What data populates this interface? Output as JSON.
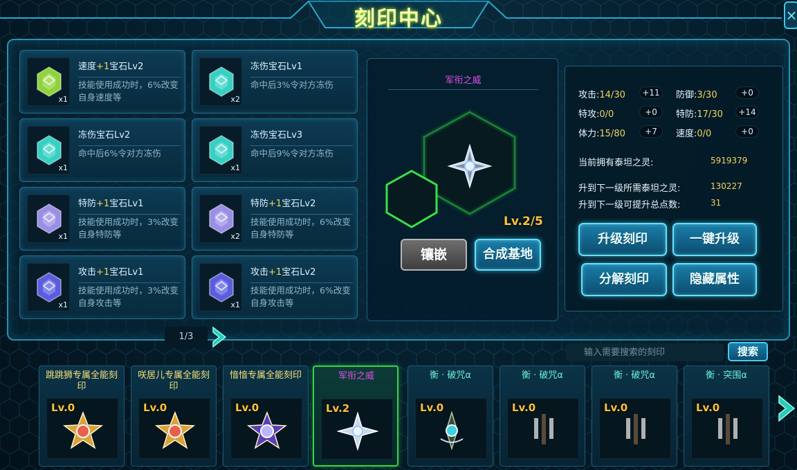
{
  "title": "刻印中心",
  "close_icon": "×",
  "inventory": {
    "items": [
      {
        "name": "速度",
        "plus": "+1",
        "rest": "宝石Lv2",
        "desc": "技能使用成功时，6%改变自身速度等",
        "count": "x1",
        "icon": "green-gem-icon",
        "color": "#8fd33a"
      },
      {
        "name": "冻伤宝石Lv1",
        "plus": "",
        "rest": "",
        "desc": "命中后3%令对方冻伤",
        "count": "x2",
        "icon": "teal-gem-icon",
        "color": "#35d1c3"
      },
      {
        "name": "冻伤宝石Lv2",
        "plus": "",
        "rest": "",
        "desc": "命中后6%令对方冻伤",
        "count": "x1",
        "icon": "teal-gem-icon",
        "color": "#35d1c3"
      },
      {
        "name": "冻伤宝石Lv3",
        "plus": "",
        "rest": "",
        "desc": "命中后9%令对方冻伤",
        "count": "x1",
        "icon": "teal-gem-icon",
        "color": "#35d1c3"
      },
      {
        "name": "特防",
        "plus": "+1",
        "rest": "宝石Lv1",
        "desc": "技能使用成功时，3%改变自身特防等",
        "count": "x1",
        "icon": "lilac-gem-icon",
        "color": "#9a8ee6"
      },
      {
        "name": "特防",
        "plus": "+1",
        "rest": "宝石Lv2",
        "desc": "技能使用成功时，6%改变自身特防等",
        "count": "x2",
        "icon": "lilac-gem-icon",
        "color": "#9a8ee6"
      },
      {
        "name": "攻击",
        "plus": "+1",
        "rest": "宝石Lv1",
        "desc": "技能使用成功时，3%改变自身攻击等",
        "count": "x1",
        "icon": "blue-gem-icon",
        "color": "#5a5de0"
      },
      {
        "name": "攻击",
        "plus": "+1",
        "rest": "宝石Lv2",
        "desc": "技能使用成功时，6%改变自身攻击等",
        "count": "x1",
        "icon": "blue-gem-icon",
        "color": "#5a5de0"
      }
    ],
    "page": "1/3"
  },
  "center": {
    "name": "军衔之威",
    "level": "Lv.2/5",
    "inlay_label": "镶嵌",
    "synth_label": "合成基地"
  },
  "stats": {
    "attack": {
      "label": "攻击:",
      "value": "14/30",
      "bonus": "+11"
    },
    "defense": {
      "label": "防御:",
      "value": "3/30",
      "bonus": "+0"
    },
    "sp_attack": {
      "label": "特攻:",
      "value": "0/0",
      "bonus": "+0"
    },
    "sp_defense": {
      "label": "特防:",
      "value": "17/30",
      "bonus": "+14"
    },
    "stamina": {
      "label": "体力:",
      "value": "15/80",
      "bonus": "+7"
    },
    "speed": {
      "label": "速度:",
      "value": "0/0",
      "bonus": "+0"
    }
  },
  "info": {
    "own_label": "当前拥有泰坦之灵:",
    "own_value": "5919379",
    "need_label": "升到下一级所需泰坦之灵:",
    "need_value": "130227",
    "points_label": "升到下一级可提升总点数:",
    "points_value": "31"
  },
  "actions": {
    "upgrade": "升级刻印",
    "one_click": "一键升级",
    "decompose": "分解刻印",
    "hidden_attr": "隐藏属性"
  },
  "search": {
    "placeholder": "输入需要搜索的刻印",
    "button": "搜索"
  },
  "bottom": [
    {
      "name": "跳跳狮专属全能刻印",
      "level": "Lv.0",
      "name_color": "yellow",
      "icon": "gold-star-emblem-icon"
    },
    {
      "name": "咲居儿专属全能刻印",
      "level": "Lv.0",
      "name_color": "yellow",
      "icon": "gold-star-emblem-icon"
    },
    {
      "name": "愔愔专属全能刻印",
      "level": "Lv.0",
      "name_color": "yellow",
      "icon": "purple-star-emblem-icon"
    },
    {
      "name": "军衔之威",
      "level": "Lv.2",
      "name_color": "pink",
      "icon": "silver-cross-emblem-icon"
    },
    {
      "name": "衡 · 破咒α",
      "level": "Lv.0",
      "name_color": "cyan",
      "icon": "spear-emblem-icon"
    },
    {
      "name": "衡 · 破咒α",
      "level": "Lv.0",
      "name_color": "cyan",
      "icon": "dim-spear-icon"
    },
    {
      "name": "衡 · 破咒α",
      "level": "Lv.0",
      "name_color": "cyan",
      "icon": "dim-spear-icon"
    },
    {
      "name": "衡 · 突围α",
      "level": "Lv.0",
      "name_color": "cyan",
      "icon": "dim-spear-icon"
    }
  ]
}
